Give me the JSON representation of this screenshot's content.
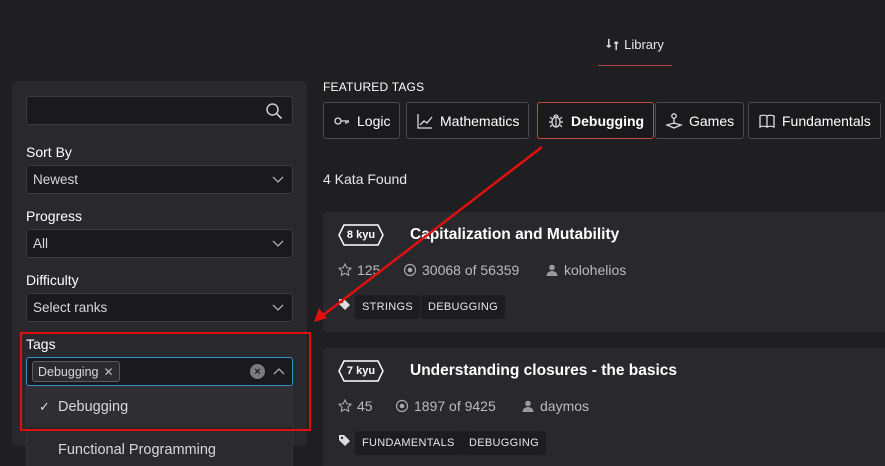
{
  "nav": {
    "library_label": "Library"
  },
  "sidebar": {
    "search": {
      "value": "",
      "placeholder": ""
    },
    "sort_by": {
      "label": "Sort By",
      "value": "Newest"
    },
    "progress": {
      "label": "Progress",
      "value": "All"
    },
    "difficulty": {
      "label": "Difficulty",
      "value": "Select ranks"
    },
    "tags": {
      "label": "Tags",
      "selected_chip": "Debugging",
      "options": [
        {
          "label": "Debugging",
          "checked": true
        },
        {
          "label": "Functional Programming",
          "checked": false
        }
      ]
    }
  },
  "featured": {
    "title": "FEATURED TAGS",
    "tags": [
      {
        "label": "Logic",
        "icon": "key-icon",
        "active": false
      },
      {
        "label": "Mathematics",
        "icon": "chart-line-icon",
        "active": false
      },
      {
        "label": "Debugging",
        "icon": "bug-icon",
        "active": true
      },
      {
        "label": "Games",
        "icon": "joystick-icon",
        "active": false
      },
      {
        "label": "Fundamentals",
        "icon": "book-icon",
        "active": false
      }
    ]
  },
  "results": {
    "count_text": "4 Kata Found",
    "katas": [
      {
        "rank": "8 kyu",
        "title": "Capitalization and Mutability",
        "stars": "125",
        "completions": "30068 of 56359",
        "author": "kolohelios",
        "tags": [
          "STRINGS",
          "DEBUGGING"
        ]
      },
      {
        "rank": "7 kyu",
        "title": "Understanding closures - the basics",
        "stars": "45",
        "completions": "1897 of 9425",
        "author": "daymos",
        "tags": [
          "FUNDAMENTALS",
          "DEBUGGING"
        ]
      }
    ]
  },
  "colors": {
    "accent": "#c24a45",
    "focus": "#2f8fc8",
    "annotation": "#e01010"
  }
}
